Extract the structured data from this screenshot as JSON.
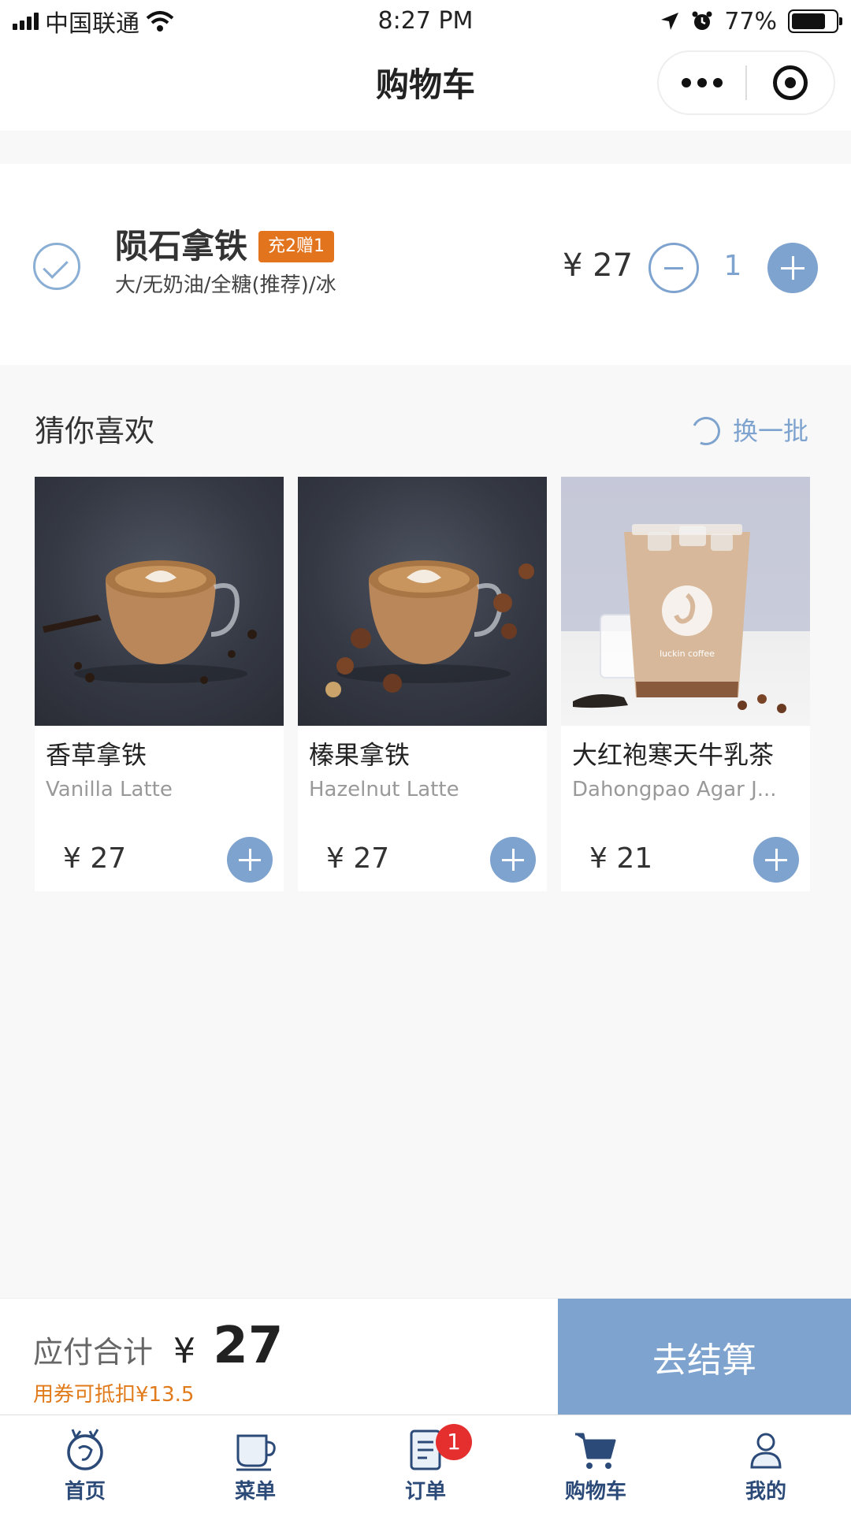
{
  "status_bar": {
    "carrier": "中国联通",
    "time": "8:27 PM",
    "battery": "77%",
    "battery_level": 0.77
  },
  "nav": {
    "title": "购物车"
  },
  "cart_item": {
    "name": "陨石拿铁",
    "badge": "充2赠1",
    "spec": "大/无奶油/全糖(推荐)/冰",
    "price": "¥ 27",
    "quantity": "1"
  },
  "recommend": {
    "title": "猜你喜欢",
    "refresh_label": "换一批",
    "items": [
      {
        "name": "香草拿铁",
        "en_name": "Vanilla Latte",
        "price": "¥ 27"
      },
      {
        "name": "榛果拿铁",
        "en_name": "Hazelnut Latte",
        "price": "¥ 27"
      },
      {
        "name": "大红袍寒天牛乳茶",
        "en_name": "Dahongpao Agar J...",
        "price": "¥ 21",
        "cup_logo": "luckin coffee"
      }
    ]
  },
  "checkout": {
    "total_label": "应付合计",
    "currency": "¥",
    "total_value": "27",
    "coupon_note": "用券可抵扣¥13.5",
    "button_label": "去结算"
  },
  "tabbar": {
    "items": [
      {
        "label": "首页",
        "icon": "deer-logo-icon"
      },
      {
        "label": "菜单",
        "icon": "cup-icon"
      },
      {
        "label": "订单",
        "icon": "receipt-icon"
      },
      {
        "label": "购物车",
        "icon": "cart-icon",
        "badge": "1"
      },
      {
        "label": "我的",
        "icon": "user-icon"
      }
    ]
  },
  "colors": {
    "accent": "#7ea3cf",
    "badge_orange": "#e3741e",
    "coupon_orange": "#e07a1a",
    "tab_text": "#2c4a78",
    "badge_red": "#e52e2e"
  }
}
